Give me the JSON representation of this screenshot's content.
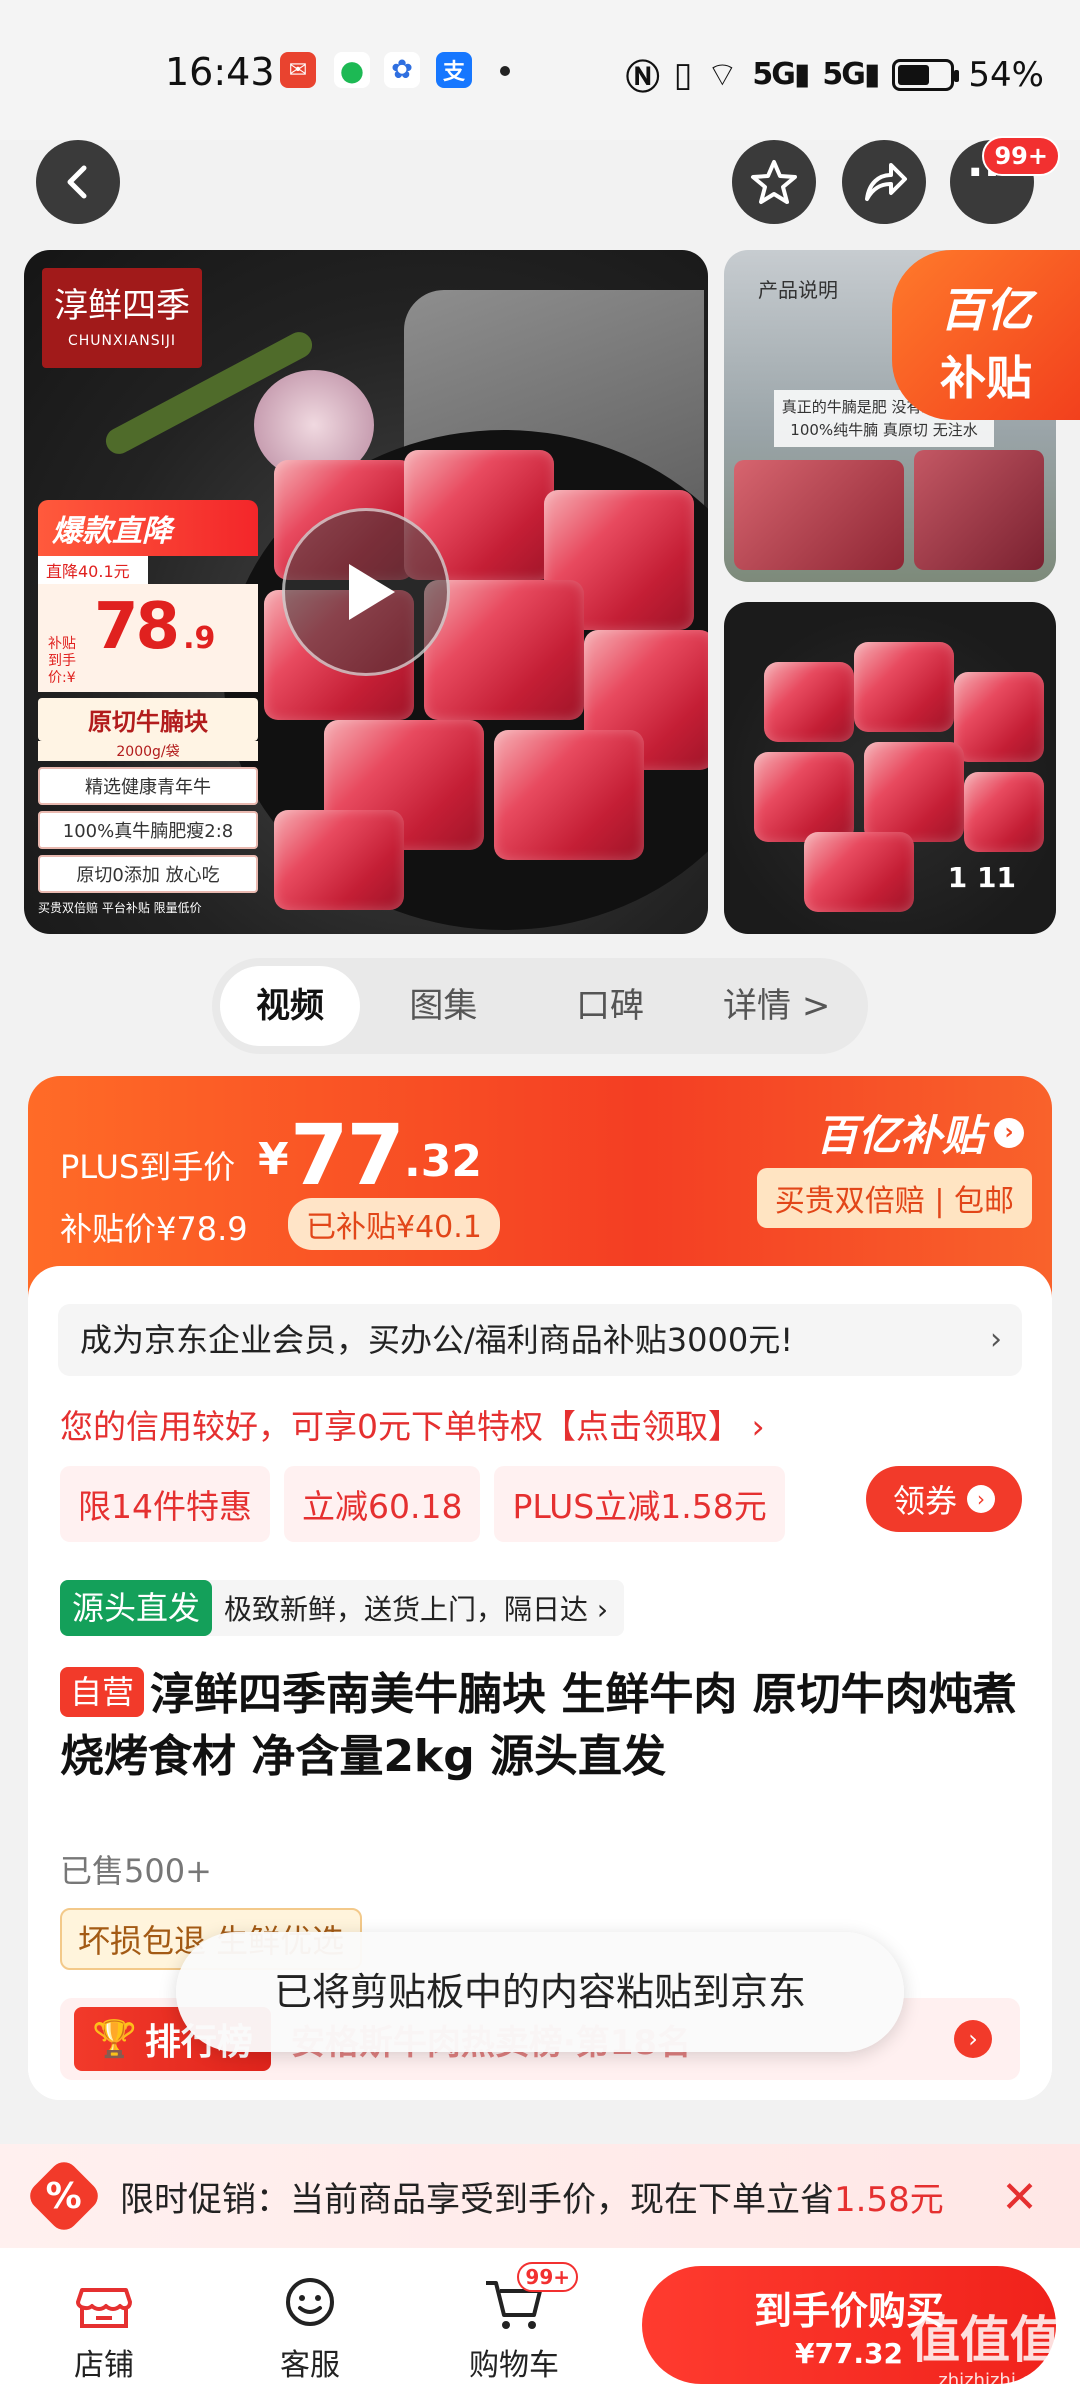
{
  "status_bar": {
    "time": "16:43",
    "network_1": "5G",
    "network_2": "5G",
    "battery": "54%"
  },
  "nav": {
    "cart_badge": "99+"
  },
  "gallery": {
    "brand_logo_cn": "淳鲜四季",
    "brand_logo_en": "CHUNXIANSIJI",
    "promo_head": "爆款直降",
    "promo_sub": "直降40.1元",
    "promo_price_label": "补贴到手价:¥",
    "promo_price_int": "78",
    "promo_price_dec": ".9",
    "promo_items": [
      "原切牛腩块",
      "精选健康青年牛",
      "100%真牛腩肥瘦2:8",
      "原切0添加 放心吃"
    ],
    "promo_weight": "2000g/袋",
    "promo_foot": "买贵双倍赔  平台补贴 限量低价",
    "thumb1_title": "产品说明",
    "thumb1_note": "真正的牛腩是肥 没有纯瘦 保证100%纯牛腩 真原切 无注水",
    "yi_badge_l1": "百亿",
    "yi_badge_l2": "补贴",
    "page_current": "1",
    "page_total": "11"
  },
  "tabs": [
    {
      "label": "视频"
    },
    {
      "label": "图集"
    },
    {
      "label": "口碑"
    },
    {
      "label": "详情 >"
    }
  ],
  "price": {
    "plus_label": "PLUS到手价",
    "yen": "¥",
    "int": "77",
    "dec": ".32",
    "subsidy_label": "补贴价¥78.9",
    "subsidy_chip": "已补贴¥40.1",
    "yi_logo": "百亿补贴",
    "guarantee": "买贵双倍赔 | 包邮"
  },
  "body": {
    "enterprise": "成为京东企业会员，买办公/福利商品补贴3000元!",
    "credit": "您的信用较好，可享0元下单特权【点击领取】 ›",
    "chips": [
      "限14件特惠",
      "立减60.18",
      "PLUS立减1.58元"
    ],
    "coupon_button": "领券",
    "source_tag": "源头直发",
    "source_text": "极致新鲜，送货上门，隔日达 ›",
    "self_tag": "自营",
    "title": "淳鲜四季南美牛腩块 生鲜牛肉 原切牛肉炖煮烧烤食材 净含量2kg 源头直发",
    "sold": "已售500+",
    "service_chip": "坏损包退  生鲜优选",
    "rank_tag": "排行榜",
    "rank_text": "安格斯牛肉热卖榜·第18名"
  },
  "toast": "已将剪贴板中的内容粘贴到京东",
  "promo_strip": {
    "text": "限时促销：当前商品享受到手价，现在下单立省",
    "amount": "1.58元"
  },
  "action_bar": {
    "store": "店铺",
    "service": "客服",
    "cart": "购物车",
    "cart_badge": "99+",
    "buy_l1": "到手价购买",
    "buy_l2": "¥77.32"
  },
  "watermark": "值值值",
  "watermark_sub": "zhizhizhi.com",
  "colors": {
    "accent_red": "#f23a2a",
    "band_orange": "#ff6b27",
    "source_green": "#14a05a"
  }
}
